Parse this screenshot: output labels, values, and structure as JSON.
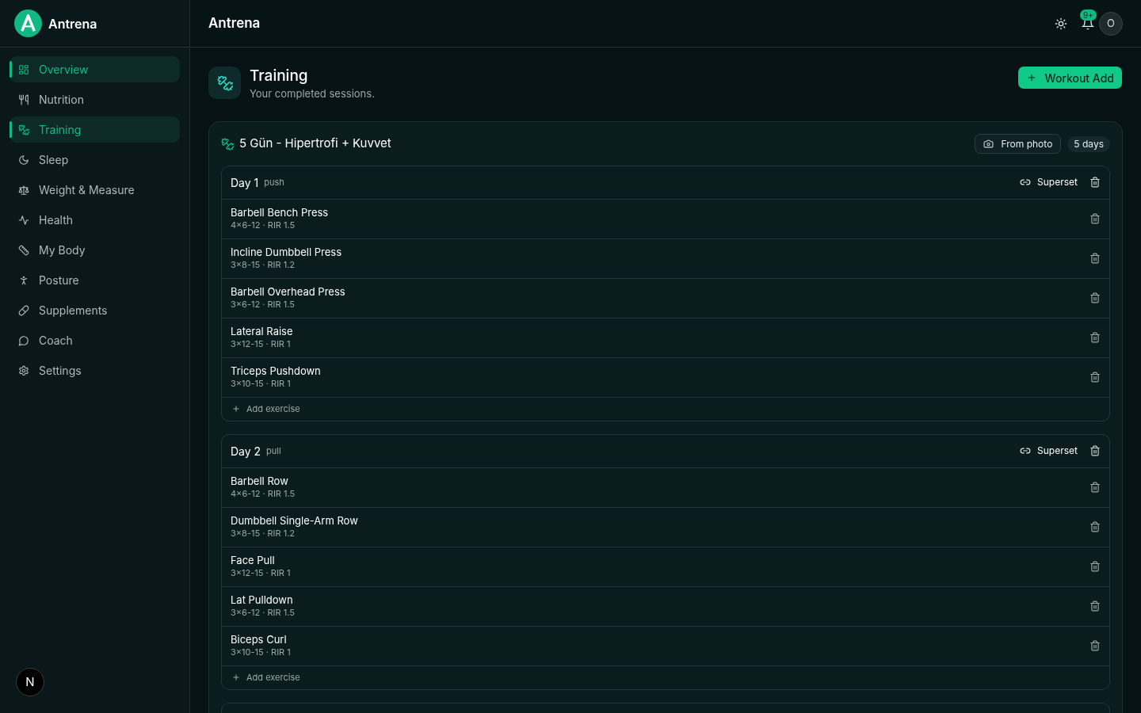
{
  "brand": {
    "name": "Antrena"
  },
  "sidebar": {
    "items": [
      {
        "label": "Overview",
        "selected": true
      },
      {
        "label": "Nutrition",
        "selected": false
      },
      {
        "label": "Training",
        "selected": true
      },
      {
        "label": "Sleep",
        "selected": false
      },
      {
        "label": "Weight & Measure",
        "selected": false
      },
      {
        "label": "Health",
        "selected": false
      },
      {
        "label": "My Body",
        "selected": false
      },
      {
        "label": "Posture",
        "selected": false
      },
      {
        "label": "Supplements",
        "selected": false
      },
      {
        "label": "Coach",
        "selected": false
      },
      {
        "label": "Settings",
        "selected": false
      }
    ]
  },
  "dev_badge": "N",
  "header": {
    "title": "Antrena",
    "notification_count": "9+",
    "avatar": "O"
  },
  "page": {
    "title": "Training",
    "subtitle": "Your completed sessions.",
    "add_button": "Workout Add"
  },
  "program": {
    "title": "5 Gün - Hipertrofi + Kuvvet",
    "photo_button": "From photo",
    "days_badge": "5 days",
    "days": [
      {
        "title": "Day 1",
        "tag": "push",
        "superset": "Superset",
        "add_label": "Add exercise",
        "exercises": [
          {
            "name": "Barbell Bench Press",
            "detail": "4×6-12 · RIR 1.5"
          },
          {
            "name": "Incline Dumbbell Press",
            "detail": "3×8-15 · RIR 1.2"
          },
          {
            "name": "Barbell Overhead Press",
            "detail": "3×6-12 · RIR 1.5"
          },
          {
            "name": "Lateral Raise",
            "detail": "3×12-15 · RIR 1"
          },
          {
            "name": "Triceps Pushdown",
            "detail": "3×10-15 · RIR 1"
          }
        ]
      },
      {
        "title": "Day 2",
        "tag": "pull",
        "superset": "Superset",
        "add_label": "Add exercise",
        "exercises": [
          {
            "name": "Barbell Row",
            "detail": "4×6-12 · RIR 1.5"
          },
          {
            "name": "Dumbbell Single-Arm Row",
            "detail": "3×8-15 · RIR 1.2"
          },
          {
            "name": "Face Pull",
            "detail": "3×12-15 · RIR 1"
          },
          {
            "name": "Lat Pulldown",
            "detail": "3×6-12 · RIR 1.5"
          },
          {
            "name": "Biceps Curl",
            "detail": "3×10-15 · RIR 1"
          }
        ]
      }
    ]
  }
}
